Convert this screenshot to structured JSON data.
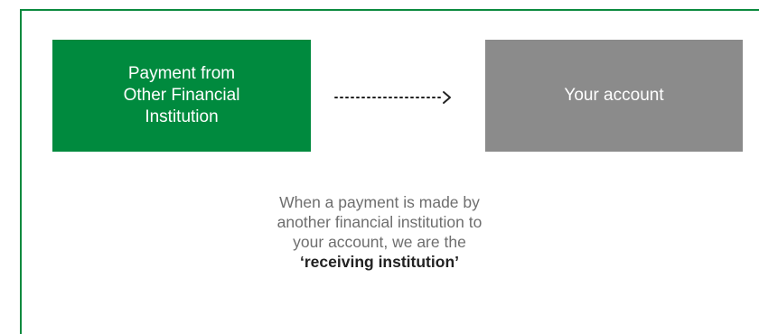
{
  "diagram": {
    "source_box": {
      "label": "Payment from\nOther Financial\nInstitution",
      "color": "#008a3e"
    },
    "destination_box": {
      "label": "Your account",
      "color": "#8b8b8b"
    },
    "arrow": {
      "style": "dotted",
      "icon": "dotted-arrow-right-icon"
    },
    "caption": {
      "lines": [
        "When a payment is made by",
        "another financial institution to",
        "your account, we are the"
      ],
      "emphasis": "‘receiving institution’"
    },
    "frame_color": "#0b8a3e"
  }
}
